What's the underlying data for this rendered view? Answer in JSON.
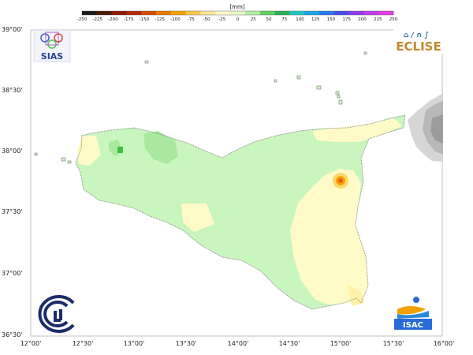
{
  "colorbar": {
    "unit": "[mm]",
    "ticks": [
      "-250",
      "-225",
      "-200",
      "-175",
      "-150",
      "-125",
      "-100",
      "-75",
      "-50",
      "-25",
      "0",
      "25",
      "50",
      "75",
      "100",
      "125",
      "150",
      "175",
      "200",
      "225",
      "250"
    ],
    "colors": [
      "#1a1a1a",
      "#4d1a00",
      "#8b1a00",
      "#b52a00",
      "#d84a00",
      "#ec7a00",
      "#f5a300",
      "#f8c84a",
      "#fbe59a",
      "#fff8c8",
      "#e7fbc8",
      "#b2f0a0",
      "#5fd35f",
      "#2bb35a",
      "#1ec7c7",
      "#1aa6e6",
      "#2a78ee",
      "#4b4df0",
      "#8d3cf0",
      "#c23cf0",
      "#e63ce6"
    ]
  },
  "axes": {
    "lat_labels": [
      "39°00'",
      "38°30'",
      "38°00'",
      "37°30'",
      "37°00'",
      "36°30'"
    ],
    "lon_labels": [
      "12°00'",
      "12°30'",
      "13°00'",
      "13°30'",
      "14°00'",
      "14°30'",
      "15°00'",
      "15°30'",
      "16°00'"
    ]
  },
  "logos": {
    "sias": "SIAS",
    "eclise": "ECLISE",
    "isac": "ISAC"
  },
  "colors": {
    "land_base": "#c9f5bf",
    "land_dry": "#fffbc8",
    "land_wetter": "#a9e89e",
    "hotspot": "#f05a1a"
  }
}
